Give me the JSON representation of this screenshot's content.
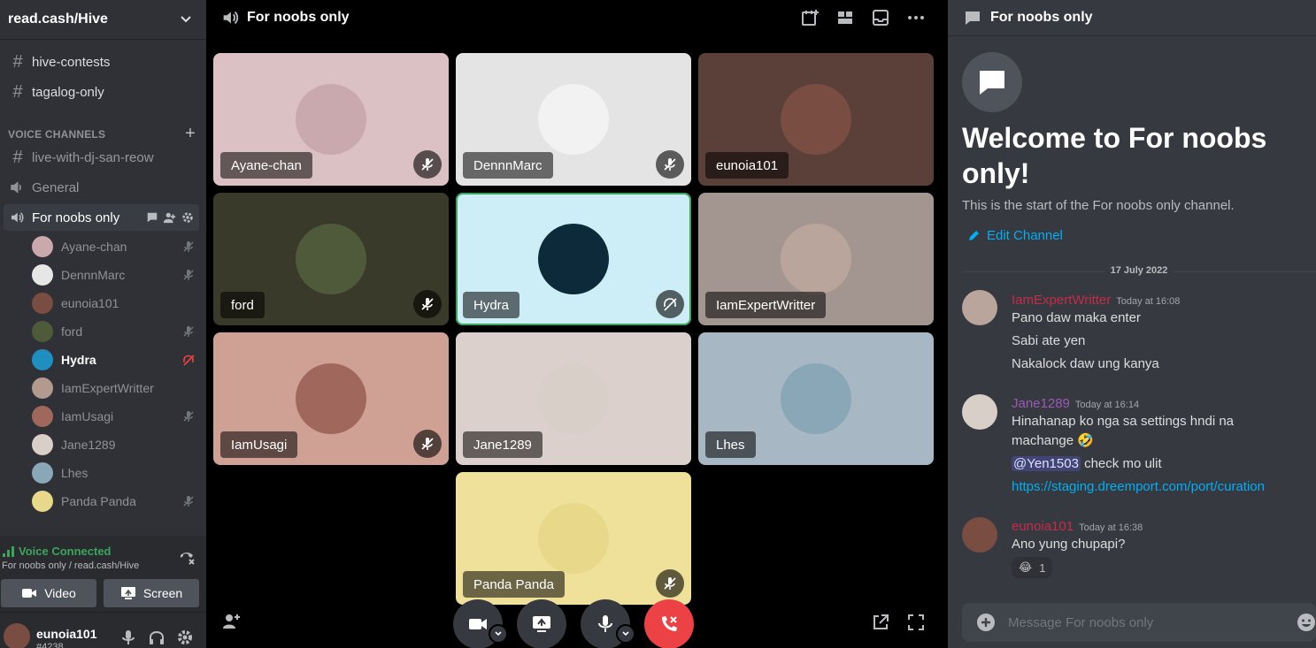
{
  "sidebar": {
    "server_name": "read.cash/Hive",
    "text_channels": [
      {
        "name": "hive-contests"
      },
      {
        "name": "tagalog-only"
      }
    ],
    "category_label": "VOICE CHANNELS",
    "voice_channels": [
      {
        "name": "live-with-dj-san-reow"
      },
      {
        "name": "General"
      },
      {
        "name": "For noobs only"
      }
    ],
    "voice_users": [
      {
        "name": "Ayane-chan",
        "muted": true,
        "color": "#c9a8ae"
      },
      {
        "name": "DennnMarc",
        "muted": true,
        "color": "#e6e6e6"
      },
      {
        "name": "eunoia101",
        "muted": false,
        "color": "#7a4d42"
      },
      {
        "name": "ford",
        "muted": true,
        "color": "#4f5a3a"
      },
      {
        "name": "Hydra",
        "muted": false,
        "color": "#1e8fbf"
      },
      {
        "name": "IamExpertWritter",
        "muted": false,
        "color": "#b39a8f"
      },
      {
        "name": "IamUsagi",
        "muted": true,
        "color": "#a0685c"
      },
      {
        "name": "Jane1289",
        "muted": false,
        "color": "#d8cfc8"
      },
      {
        "name": "Lhes",
        "muted": false,
        "color": "#8aa7b8"
      },
      {
        "name": "Panda Panda",
        "muted": true,
        "color": "#e8d88a"
      }
    ]
  },
  "voice_panel": {
    "status": "Voice Connected",
    "location": "For noobs only / read.cash/Hive",
    "video_label": "Video",
    "screen_label": "Screen"
  },
  "user_panel": {
    "username": "eunoia101",
    "tag": "#4238"
  },
  "main": {
    "title": "For noobs only",
    "tiles": [
      {
        "name": "Ayane-chan",
        "bg": "#dcc1c4",
        "avatar": "#c9a8ae",
        "muted": true
      },
      {
        "name": "DennnMarc",
        "bg": "#e4e4e4",
        "avatar": "#f2f2f2",
        "muted": true
      },
      {
        "name": "eunoia101",
        "bg": "#5b3f39",
        "avatar": "#7a4d42",
        "muted": false
      },
      {
        "name": "ford",
        "bg": "#3a3a2a",
        "avatar": "#4f5a3a",
        "muted": true
      },
      {
        "name": "Hydra",
        "bg": "#cdeef6",
        "avatar": "#0d2a3b",
        "muted": false,
        "speaking": true
      },
      {
        "name": "IamExpertWritter",
        "bg": "#a39590",
        "avatar": "#b9a59c",
        "muted": false
      },
      {
        "name": "IamUsagi",
        "bg": "#cfa094",
        "avatar": "#a0685c",
        "muted": true
      },
      {
        "name": "Jane1289",
        "bg": "#dcd0cc",
        "avatar": "#d8cfc8",
        "muted": false
      },
      {
        "name": "Lhes",
        "bg": "#a7b7c4",
        "avatar": "#8aa7b8",
        "muted": false
      },
      {
        "name": "Panda Panda",
        "bg": "#efe09a",
        "avatar": "#e8d88a",
        "muted": true
      }
    ]
  },
  "chat": {
    "title": "For noobs only",
    "welcome_title": "Welcome to For noobs only!",
    "welcome_sub": "This is the start of the For noobs only channel.",
    "edit_channel": "Edit Channel",
    "date_divider": "17 July 2022",
    "messages": [
      {
        "author": "IamExpertWritter",
        "time": "Today at 16:08",
        "color": "#c22d4a",
        "avatar": "#b9a59c",
        "lines": [
          "Pano daw maka enter",
          "Sabi ate yen",
          "Nakalock daw ung kanya"
        ]
      },
      {
        "author": "Jane1289",
        "time": "Today at 16:14",
        "color": "#9b59b6",
        "avatar": "#d8cfc8",
        "line1": "Hinahanap ko nga sa settings hndi na",
        "line2": "machange",
        "line2_emoji": "🤣",
        "mention": "@Yen1503",
        "mention_after": "check mo ulit",
        "link": "https://staging.dreemport.com/port/curation"
      },
      {
        "author": "eunoia101",
        "time": "Today at 16:38",
        "color": "#c22d4a",
        "avatar": "#7a4d42",
        "lines": [
          "Ano yung chupapi?"
        ],
        "reaction_emoji": "😂",
        "reaction_count": "1"
      }
    ],
    "input_placeholder": "Message For noobs only"
  },
  "colors": {
    "accent_green": "#3ba55d",
    "danger": "#ed4245",
    "link": "#00aff4"
  }
}
